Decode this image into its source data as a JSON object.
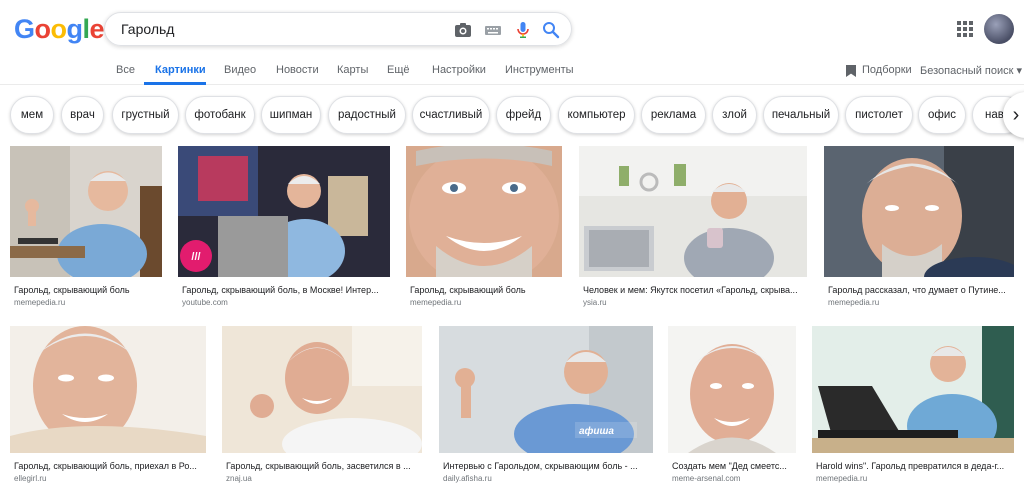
{
  "header": {
    "logo": {
      "g1": "G",
      "o1": "o",
      "o2": "o",
      "g2": "g",
      "l": "l",
      "e": "e"
    },
    "query": "Гарольд",
    "icons": [
      "camera-icon",
      "keyboard-icon",
      "microphone-icon",
      "search-icon",
      "apps-icon",
      "avatar"
    ]
  },
  "tabs": [
    {
      "label": "Все"
    },
    {
      "label": "Картинки"
    },
    {
      "label": "Видео"
    },
    {
      "label": "Новости"
    },
    {
      "label": "Карты"
    },
    {
      "label": "Ещё"
    },
    {
      "label": "Настройки"
    },
    {
      "label": "Инструменты"
    }
  ],
  "right_links": {
    "collections": "Подборки",
    "safe_search": "Безопасный поиск ▾"
  },
  "chips": [
    "мем",
    "врач",
    "грустный",
    "фотобанк",
    "шипман",
    "радостный",
    "счастливый",
    "фрейд",
    "компьютер",
    "реклама",
    "злой",
    "печальный",
    "пистолет",
    "офис",
    "нава"
  ],
  "results": [
    {
      "caption": "Гарольд, скрывающий боль",
      "source": "memepedia.ru"
    },
    {
      "caption": "Гарольд, скрывающий боль, в Москве! Интер...",
      "source": "youtube.com",
      "overlay": "///"
    },
    {
      "caption": "Гарольд, скрывающий боль",
      "source": "memepedia.ru"
    },
    {
      "caption": "Человек и мем: Якутск посетил «Гарольд, скрыва...",
      "source": "ysia.ru"
    },
    {
      "caption": "Гарольд рассказал, что думает о Путине...",
      "source": "memepedia.ru"
    },
    {
      "caption": "Гарольд, скрывающий боль, приехал в Ро...",
      "source": "ellegirl.ru"
    },
    {
      "caption": "Гарольд, скрывающий боль, засветился в ...",
      "source": "znaj.ua"
    },
    {
      "caption": "Интервью с Гарольдом, скрывающим боль - ...",
      "source": "daily.afisha.ru",
      "overlay": "афиша"
    },
    {
      "caption": "Создать мем \"Дед смеетс...",
      "source": "meme-arsenal.com"
    },
    {
      "caption": "Harold wins\". Гарольд превратился в деда-г...",
      "source": "memepedia.ru"
    }
  ],
  "colors": {
    "accent": "#1a73e8",
    "blue": "#4285f4",
    "red": "#ea4335",
    "yellow": "#fbbc05",
    "green": "#34a853"
  }
}
